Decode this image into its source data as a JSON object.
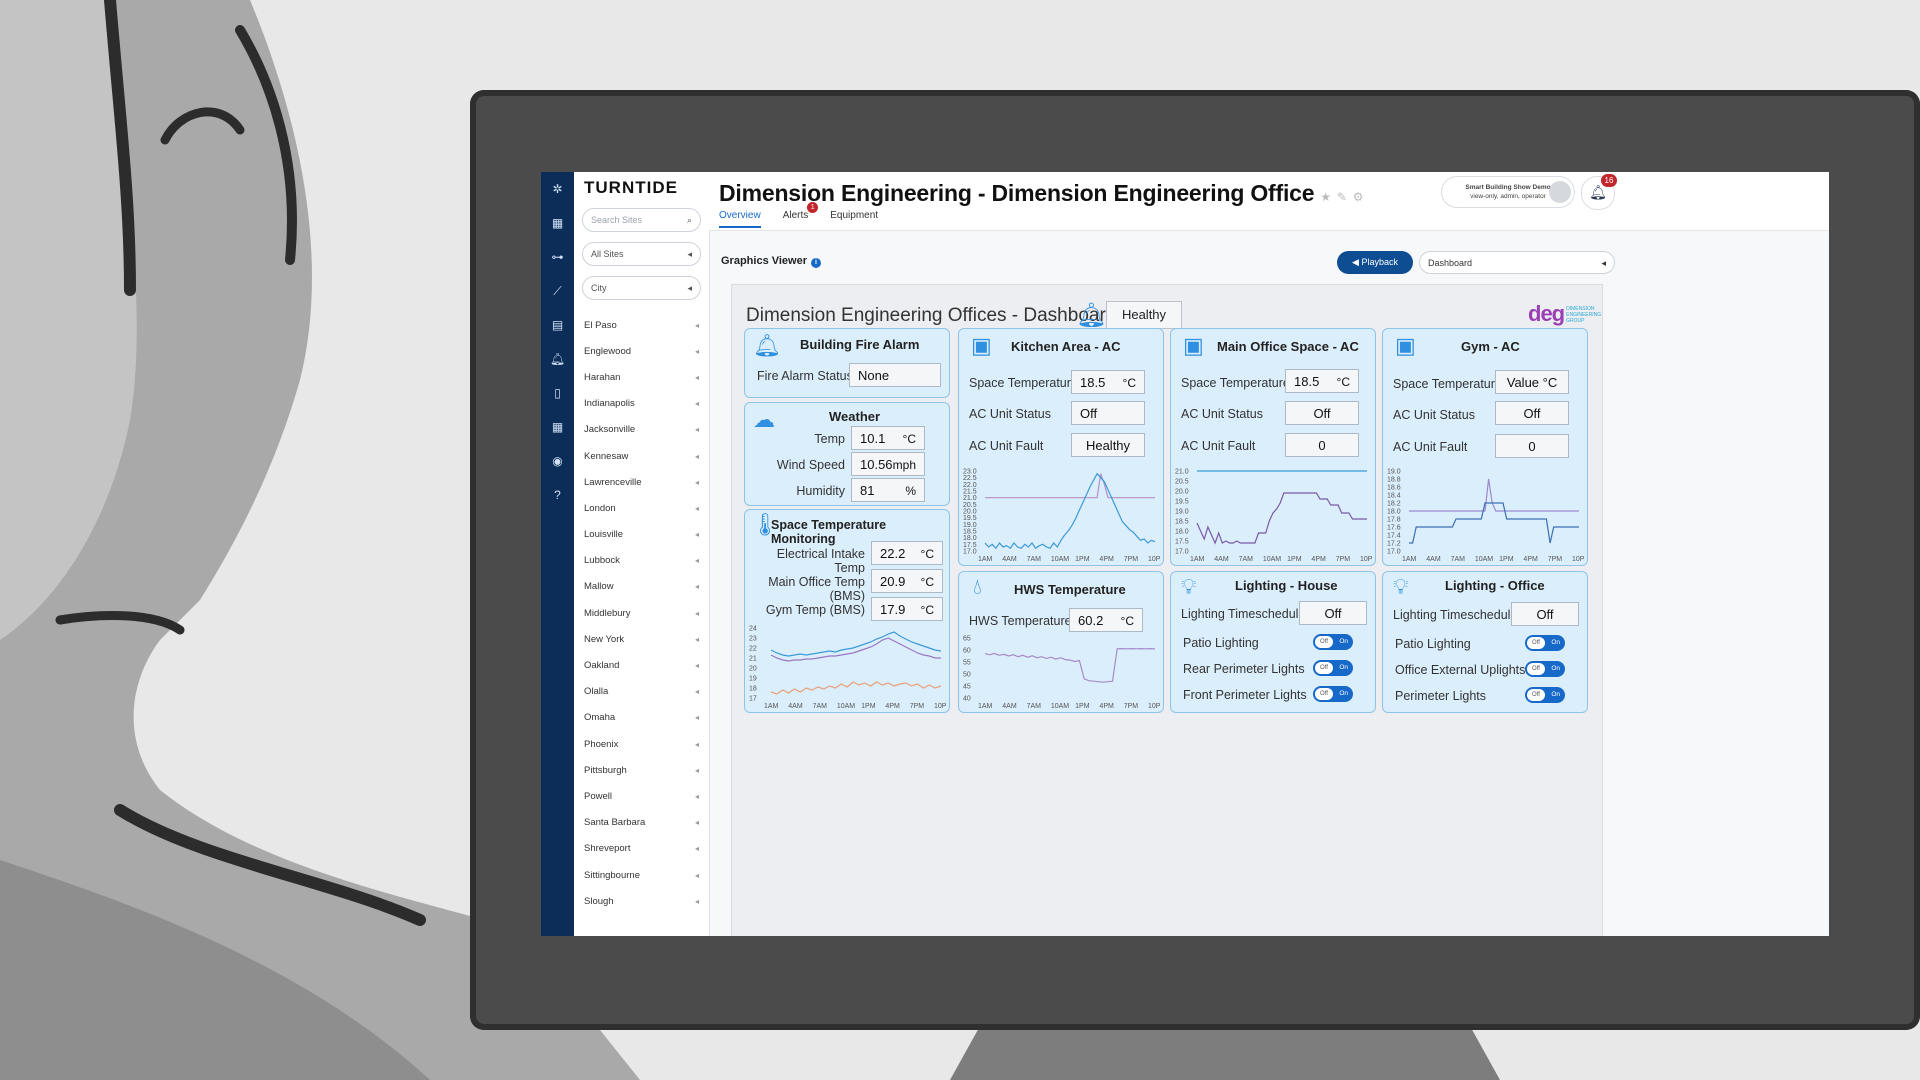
{
  "brand": "TURNTIDE",
  "sites_panel": {
    "search_placeholder": "Search Sites",
    "filter_all": "All Sites",
    "filter_city": "City",
    "cities": [
      "El Paso",
      "Englewood",
      "Harahan",
      "Indianapolis",
      "Jacksonville",
      "Kennesaw",
      "Lawrenceville",
      "London",
      "Louisville",
      "Lubbock",
      "Mallow",
      "Middlebury",
      "New York",
      "Oakland",
      "Olalla",
      "Omaha",
      "Phoenix",
      "Pittsburgh",
      "Powell",
      "Santa Barbara",
      "Shreveport",
      "Sittingbourne",
      "Slough"
    ]
  },
  "header": {
    "title": "Dimension Engineering - Dimension Engineering Office",
    "tabs": [
      {
        "label": "Overview",
        "active": true
      },
      {
        "label": "Alerts",
        "badge": "1"
      },
      {
        "label": "Equipment"
      }
    ],
    "user_line1": "Smart Building Show Demo",
    "user_line2": "view-only, admin, operator",
    "notification_count": "16"
  },
  "graphics_viewer": {
    "label": "Graphics Viewer",
    "playback_label": "Playback",
    "dashboard_select": "Dashboard"
  },
  "dashboard": {
    "title": "Dimension Engineering Offices - Dashboard",
    "status": "Healthy",
    "logo_text": "deg",
    "logo_sub": "DIMENSION ENGINEERING GROUP",
    "fire_alarm": {
      "title": "Building Fire Alarm",
      "status_label": "Fire Alarm Status",
      "status_value": "None"
    },
    "weather": {
      "title": "Weather",
      "rows": [
        {
          "label": "Temp",
          "value": "10.1",
          "unit": "°C"
        },
        {
          "label": "Wind Speed",
          "value": "10.56",
          "unit": "mph"
        },
        {
          "label": "Humidity",
          "value": "81",
          "unit": "%"
        }
      ]
    },
    "space_temp": {
      "title": "Space Temperature Monitoring",
      "rows": [
        {
          "label": "Electrical Intake Temp",
          "value": "22.2",
          "unit": "°C"
        },
        {
          "label": "Main Office Temp (BMS)",
          "value": "20.9",
          "unit": "°C"
        },
        {
          "label": "Gym Temp (BMS)",
          "value": "17.9",
          "unit": "°C"
        }
      ]
    },
    "kitchen_ac": {
      "title": "Kitchen Area - AC",
      "temp_label": "Space Temperature",
      "temp_value": "18.5",
      "temp_unit": "°C",
      "status_label": "AC Unit Status",
      "status_value": "Off",
      "fault_label": "AC Unit Fault",
      "fault_value": "Healthy"
    },
    "main_office_ac": {
      "title": "Main Office Space - AC",
      "temp_label": "Space Temperature",
      "temp_value": "18.5",
      "temp_unit": "°C",
      "status_label": "AC Unit Status",
      "status_value": "Off",
      "fault_label": "AC Unit Fault",
      "fault_value": "0"
    },
    "gym_ac": {
      "title": "Gym - AC",
      "temp_label": "Space Temperature",
      "temp_value": "Value °C",
      "status_label": "AC Unit Status",
      "status_value": "Off",
      "fault_label": "AC Unit Fault",
      "fault_value": "0"
    },
    "hws": {
      "title": "HWS Temperature",
      "temp_label": "HWS Temperature",
      "temp_value": "60.2",
      "temp_unit": "°C"
    },
    "lighting_house": {
      "title": "Lighting - House",
      "schedule_label": "Lighting Timeschedule",
      "schedule_value": "Off",
      "toggles": [
        {
          "label": "Patio Lighting"
        },
        {
          "label": "Rear Perimeter Lights"
        },
        {
          "label": "Front Perimeter Lights"
        }
      ]
    },
    "lighting_office": {
      "title": "Lighting - Office",
      "schedule_label": "Lighting Timeschedule",
      "schedule_value": "Off",
      "toggles": [
        {
          "label": "Patio Lighting"
        },
        {
          "label": "Office External Uplights"
        },
        {
          "label": "Perimeter Lights"
        }
      ]
    },
    "toggle_off": "Off",
    "toggle_on": "On"
  },
  "chart_data": [
    {
      "type": "line",
      "panel": "kitchen",
      "x": [
        "1AM",
        "4AM",
        "7AM",
        "10AM",
        "1PM",
        "4PM",
        "7PM",
        "10PM"
      ],
      "ylim": [
        17.0,
        23.0
      ],
      "yticks": [
        "23.0",
        "22.5",
        "22.0",
        "21.5",
        "21.0",
        "20.5",
        "20.0",
        "19.5",
        "19.0",
        "18.5",
        "18.0",
        "17.5",
        "17.0"
      ],
      "series": [
        {
          "color": "#b58fc9",
          "values": [
            21.0,
            21.0,
            21.0,
            21.0,
            21.0,
            21.0,
            21.0,
            21.0,
            21.0,
            21.0,
            21.0,
            21.0,
            21.0,
            21.0,
            21.0,
            21.0,
            21.0,
            21.0,
            21.0,
            21.0,
            21.0,
            21.0,
            21.0,
            21.0,
            21.0,
            21.0,
            21.0,
            21.0,
            21.0,
            21.0,
            21.0,
            21.0,
            22.8,
            22.0,
            21.0,
            21.0,
            21.0,
            21.0,
            21.0,
            21.0,
            21.0,
            21.0,
            21.0,
            21.0,
            21.0,
            21.0,
            21.0,
            21.0
          ]
        },
        {
          "color": "#3b9ad8",
          "values": [
            17.6,
            17.3,
            17.5,
            17.2,
            17.6,
            17.3,
            17.4,
            17.2,
            17.6,
            17.3,
            17.2,
            17.5,
            17.3,
            17.6,
            17.2,
            17.4,
            17.5,
            17.3,
            17.2,
            17.6,
            17.3,
            17.8,
            18.2,
            18.5,
            18.9,
            19.4,
            20.0,
            20.6,
            21.2,
            21.8,
            22.3,
            22.8,
            22.5,
            22.2,
            21.6,
            21.0,
            20.4,
            19.8,
            19.2,
            18.9,
            18.6,
            18.4,
            18.1,
            17.8,
            17.9,
            17.6,
            17.8,
            17.7
          ]
        }
      ]
    },
    {
      "type": "line",
      "panel": "main_office",
      "x": [
        "1AM",
        "4AM",
        "7AM",
        "10AM",
        "1PM",
        "4PM",
        "7PM",
        "10PM"
      ],
      "ylim": [
        17.0,
        21.0
      ],
      "yticks": [
        "21.0",
        "20.5",
        "20.0",
        "19.5",
        "19.0",
        "18.5",
        "18.0",
        "17.5",
        "17.0"
      ],
      "series": [
        {
          "color": "#3b9ad8",
          "values": [
            21.0,
            21.0,
            21.0,
            21.0,
            21.0,
            21.0,
            21.0,
            21.0,
            21.0,
            21.0,
            21.0,
            21.0,
            21.0,
            21.0,
            21.0,
            21.0,
            21.0,
            21.0,
            21.0,
            21.0,
            21.0,
            21.0,
            21.0,
            21.0,
            21.0,
            21.0,
            21.0,
            21.0,
            21.0,
            21.0,
            21.0,
            21.0,
            21.0,
            21.0,
            21.0,
            21.0,
            21.0,
            21.0,
            21.0,
            21.0,
            21.0,
            21.0,
            21.0,
            21.0,
            21.0,
            21.0,
            21.0,
            21.0
          ]
        },
        {
          "color": "#7a5aa8",
          "values": [
            18.4,
            18.0,
            17.6,
            18.2,
            17.8,
            17.4,
            17.9,
            17.4,
            17.5,
            17.4,
            17.4,
            17.5,
            17.4,
            17.4,
            17.4,
            17.4,
            17.4,
            17.9,
            17.9,
            17.9,
            18.5,
            18.9,
            19.1,
            19.4,
            19.9,
            19.9,
            19.9,
            19.9,
            19.9,
            19.9,
            19.9,
            19.9,
            19.9,
            19.9,
            19.6,
            19.6,
            19.6,
            19.3,
            19.3,
            19.3,
            18.9,
            18.9,
            18.9,
            18.6,
            18.6,
            18.6,
            18.6,
            18.6
          ]
        }
      ]
    },
    {
      "type": "line",
      "panel": "gym",
      "x": [
        "1AM",
        "4AM",
        "7AM",
        "10AM",
        "1PM",
        "4PM",
        "7PM",
        "10PM"
      ],
      "ylim": [
        17.0,
        19.0
      ],
      "yticks": [
        "19.0",
        "18.8",
        "18.6",
        "18.4",
        "18.2",
        "18.0",
        "17.8",
        "17.6",
        "17.4",
        "17.2",
        "17.0"
      ],
      "series": [
        {
          "color": "#9e89d0",
          "values": [
            18.0,
            18.0,
            18.0,
            18.0,
            18.0,
            18.0,
            18.0,
            18.0,
            18.0,
            18.0,
            18.0,
            18.0,
            18.0,
            18.0,
            18.0,
            18.0,
            18.0,
            18.0,
            18.0,
            18.0,
            18.0,
            18.0,
            18.8,
            18.2,
            18.0,
            18.0,
            18.0,
            18.0,
            18.0,
            18.0,
            18.0,
            18.0,
            18.0,
            18.0,
            18.0,
            18.0,
            18.0,
            18.0,
            18.0,
            18.0,
            18.0,
            18.0,
            18.0,
            18.0,
            18.0,
            18.0,
            18.0,
            18.0
          ]
        },
        {
          "color": "#3b6fb5",
          "values": [
            17.2,
            17.2,
            17.6,
            17.6,
            17.6,
            17.6,
            17.6,
            17.6,
            17.6,
            17.6,
            17.6,
            17.6,
            17.6,
            17.8,
            17.8,
            17.8,
            17.8,
            17.8,
            17.8,
            17.8,
            17.8,
            18.2,
            18.2,
            18.2,
            18.2,
            18.2,
            18.2,
            17.8,
            17.8,
            17.8,
            17.8,
            17.8,
            17.8,
            17.8,
            17.8,
            17.8,
            17.8,
            17.8,
            17.8,
            17.2,
            17.6,
            17.6,
            17.6,
            17.6,
            17.6,
            17.6,
            17.6,
            17.6
          ]
        }
      ]
    },
    {
      "type": "line",
      "panel": "space_temp",
      "x": [
        "1AM",
        "4AM",
        "7AM",
        "10AM",
        "1PM",
        "4PM",
        "7PM",
        "10PM"
      ],
      "ylim": [
        17,
        24
      ],
      "yticks": [
        "24",
        "23",
        "22",
        "21",
        "20",
        "19",
        "18",
        "17"
      ],
      "series": [
        {
          "color": "#3b9ad8",
          "values": [
            21.8,
            21.5,
            21.3,
            21.2,
            21.3,
            21.4,
            21.3,
            21.4,
            21.5,
            21.6,
            21.7,
            21.6,
            21.8,
            21.9,
            22.0,
            22.2,
            22.4,
            22.6,
            22.9,
            23.1,
            23.4,
            23.6,
            23.2,
            22.9,
            22.6,
            22.4,
            22.2,
            22.0,
            21.8,
            21.7
          ]
        },
        {
          "color": "#9a78c0",
          "values": [
            21.3,
            21.0,
            20.8,
            20.7,
            20.8,
            20.8,
            20.9,
            20.9,
            21.0,
            21.1,
            21.2,
            21.2,
            21.3,
            21.4,
            21.5,
            21.7,
            21.9,
            22.1,
            22.4,
            22.8,
            23.0,
            22.7,
            22.4,
            22.1,
            21.8,
            21.5,
            21.3,
            21.2,
            21.0,
            21.0
          ]
        },
        {
          "color": "#e8a07a",
          "values": [
            17.6,
            17.4,
            17.8,
            17.5,
            17.9,
            17.6,
            18.0,
            17.8,
            18.1,
            17.9,
            18.2,
            18.0,
            18.4,
            18.1,
            18.6,
            18.3,
            18.5,
            18.2,
            18.6,
            18.3,
            18.5,
            18.2,
            18.4,
            18.5,
            18.2,
            18.4,
            18.0,
            18.3,
            18.0,
            18.2
          ]
        }
      ]
    },
    {
      "type": "line",
      "panel": "hws",
      "x": [
        "1AM",
        "4AM",
        "7AM",
        "10AM",
        "1PM",
        "4PM",
        "7PM",
        "10PM"
      ],
      "ylim": [
        40,
        65
      ],
      "yticks": [
        "65",
        "60",
        "55",
        "50",
        "45",
        "40"
      ],
      "series": [
        {
          "color": "#a88bc8",
          "values": [
            58.5,
            58.0,
            58.6,
            57.8,
            58.2,
            57.5,
            58.0,
            57.2,
            57.8,
            57.0,
            57.6,
            56.8,
            57.2,
            56.5,
            57.0,
            56.2,
            56.8,
            56.0,
            55.8,
            55.2,
            55.6,
            48.0,
            47.2,
            47.0,
            46.8,
            46.6,
            46.8,
            47.0,
            60.5,
            60.6,
            60.5,
            60.6,
            60.5,
            60.6,
            60.5,
            60.6,
            60.5
          ]
        }
      ]
    }
  ],
  "colors": {
    "rail": "#0b2d57",
    "accent": "#1769c9",
    "panel_bg": "#dbeefb",
    "panel_border": "#8fc4ea",
    "alert": "#c0262c"
  }
}
